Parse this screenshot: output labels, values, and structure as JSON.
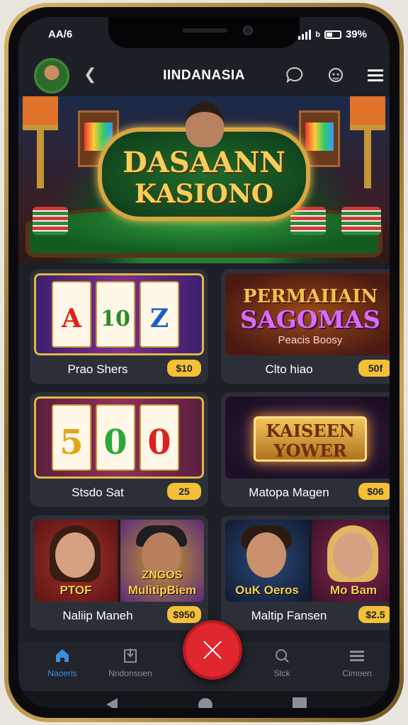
{
  "status": {
    "time": "AA/6",
    "sim_mark": "b",
    "battery": "39%"
  },
  "header": {
    "title": "IINDANASIA"
  },
  "banner": {
    "line1": "DASAANN",
    "line2": "KASIONO"
  },
  "games": [
    {
      "name": "Prao Shers",
      "amount": "$10"
    },
    {
      "name": "Clto hiao",
      "amount": "50f"
    },
    {
      "name": "Stsdo Sat",
      "amount": "25"
    },
    {
      "name": "Matopa Magen",
      "amount": "$06"
    },
    {
      "name": "Naliip Maneh",
      "amount": "$950"
    },
    {
      "name": "Maltip Fansen",
      "amount": "$2.5"
    }
  ],
  "promo1": {
    "line1": "PERMAIIAIN",
    "line2": "SAGOMAS",
    "line3": "Peacis Boosy"
  },
  "promo2": {
    "line1": "KAISEEN",
    "line2": "YOWER"
  },
  "reels1": [
    "A",
    "10",
    "Z"
  ],
  "reels2": [
    "5",
    "0",
    "0"
  ],
  "portraits": [
    {
      "caption": "PTOF"
    },
    {
      "caption_top": "ZNGOS",
      "caption": "MulitipBiem"
    },
    {
      "caption": "OuK Oeros"
    },
    {
      "caption": "Mo Bam"
    }
  ],
  "nav": [
    {
      "label": "Naoeris",
      "icon": "home-icon",
      "active": true
    },
    {
      "label": "Nndonsoen",
      "icon": "download-icon",
      "active": false
    },
    {
      "label": "Stck",
      "icon": "search-icon",
      "active": false
    },
    {
      "label": "Cimoen",
      "icon": "menu-icon",
      "active": false
    }
  ],
  "colors": {
    "accent": "#3b8fe0",
    "fab": "#e0262f",
    "badge": "#f3c037",
    "background": "#1d1f27"
  }
}
